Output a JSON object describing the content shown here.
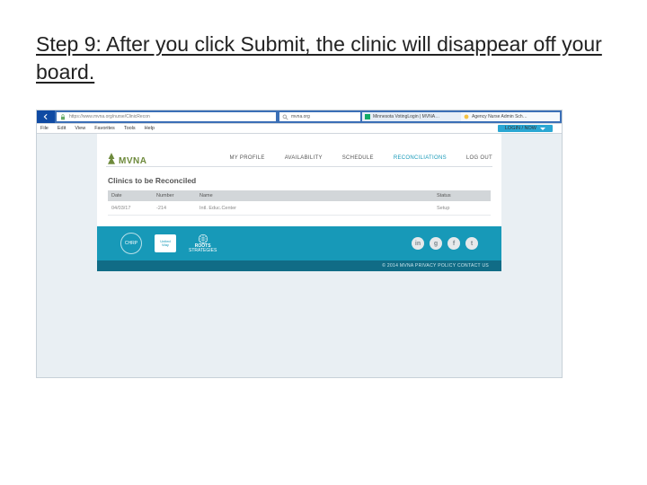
{
  "heading": "Step 9: After you click Submit, the clinic will disappear off your board.",
  "browser": {
    "url_text": "https://www.mvna.org/nurse/ClinicRecon",
    "search_text": "mvna.org",
    "search_prefix": "🔍",
    "tab1": "Minnesota VotingLogin | MVNA…",
    "tab2": "Agency Nurse Admin Sch…"
  },
  "menubar": [
    "File",
    "Edit",
    "View",
    "Favorites",
    "Tools",
    "Help"
  ],
  "login_button": "LOGIN / NOW",
  "logo_text": "MVNA",
  "nav": [
    {
      "label": "MY PROFILE",
      "active": false
    },
    {
      "label": "AVAILABILITY",
      "active": false
    },
    {
      "label": "SCHEDULE",
      "active": false
    },
    {
      "label": "RECONCILIATIONS",
      "active": true
    },
    {
      "label": "LOG OUT",
      "active": false
    }
  ],
  "panel_title": "Clinics to be Reconciled",
  "columns": {
    "date": "Date",
    "number": "Number",
    "name": "Name",
    "status": "Status"
  },
  "row": {
    "date": "04/03/17",
    "number": "-214",
    "name": "Intl. Educ.Center",
    "status": "Setup"
  },
  "sponsors": {
    "item1": "CHRP",
    "item2a": "United",
    "item2b": "Way",
    "item3a": "ROOTS",
    "item3b": "STRATEGIES"
  },
  "socials": {
    "in": "in",
    "gp": "g",
    "fb": "f",
    "tw": "t"
  },
  "footer_legal": "© 2014 MVNA  PRIVACY POLICY  CONTACT US"
}
